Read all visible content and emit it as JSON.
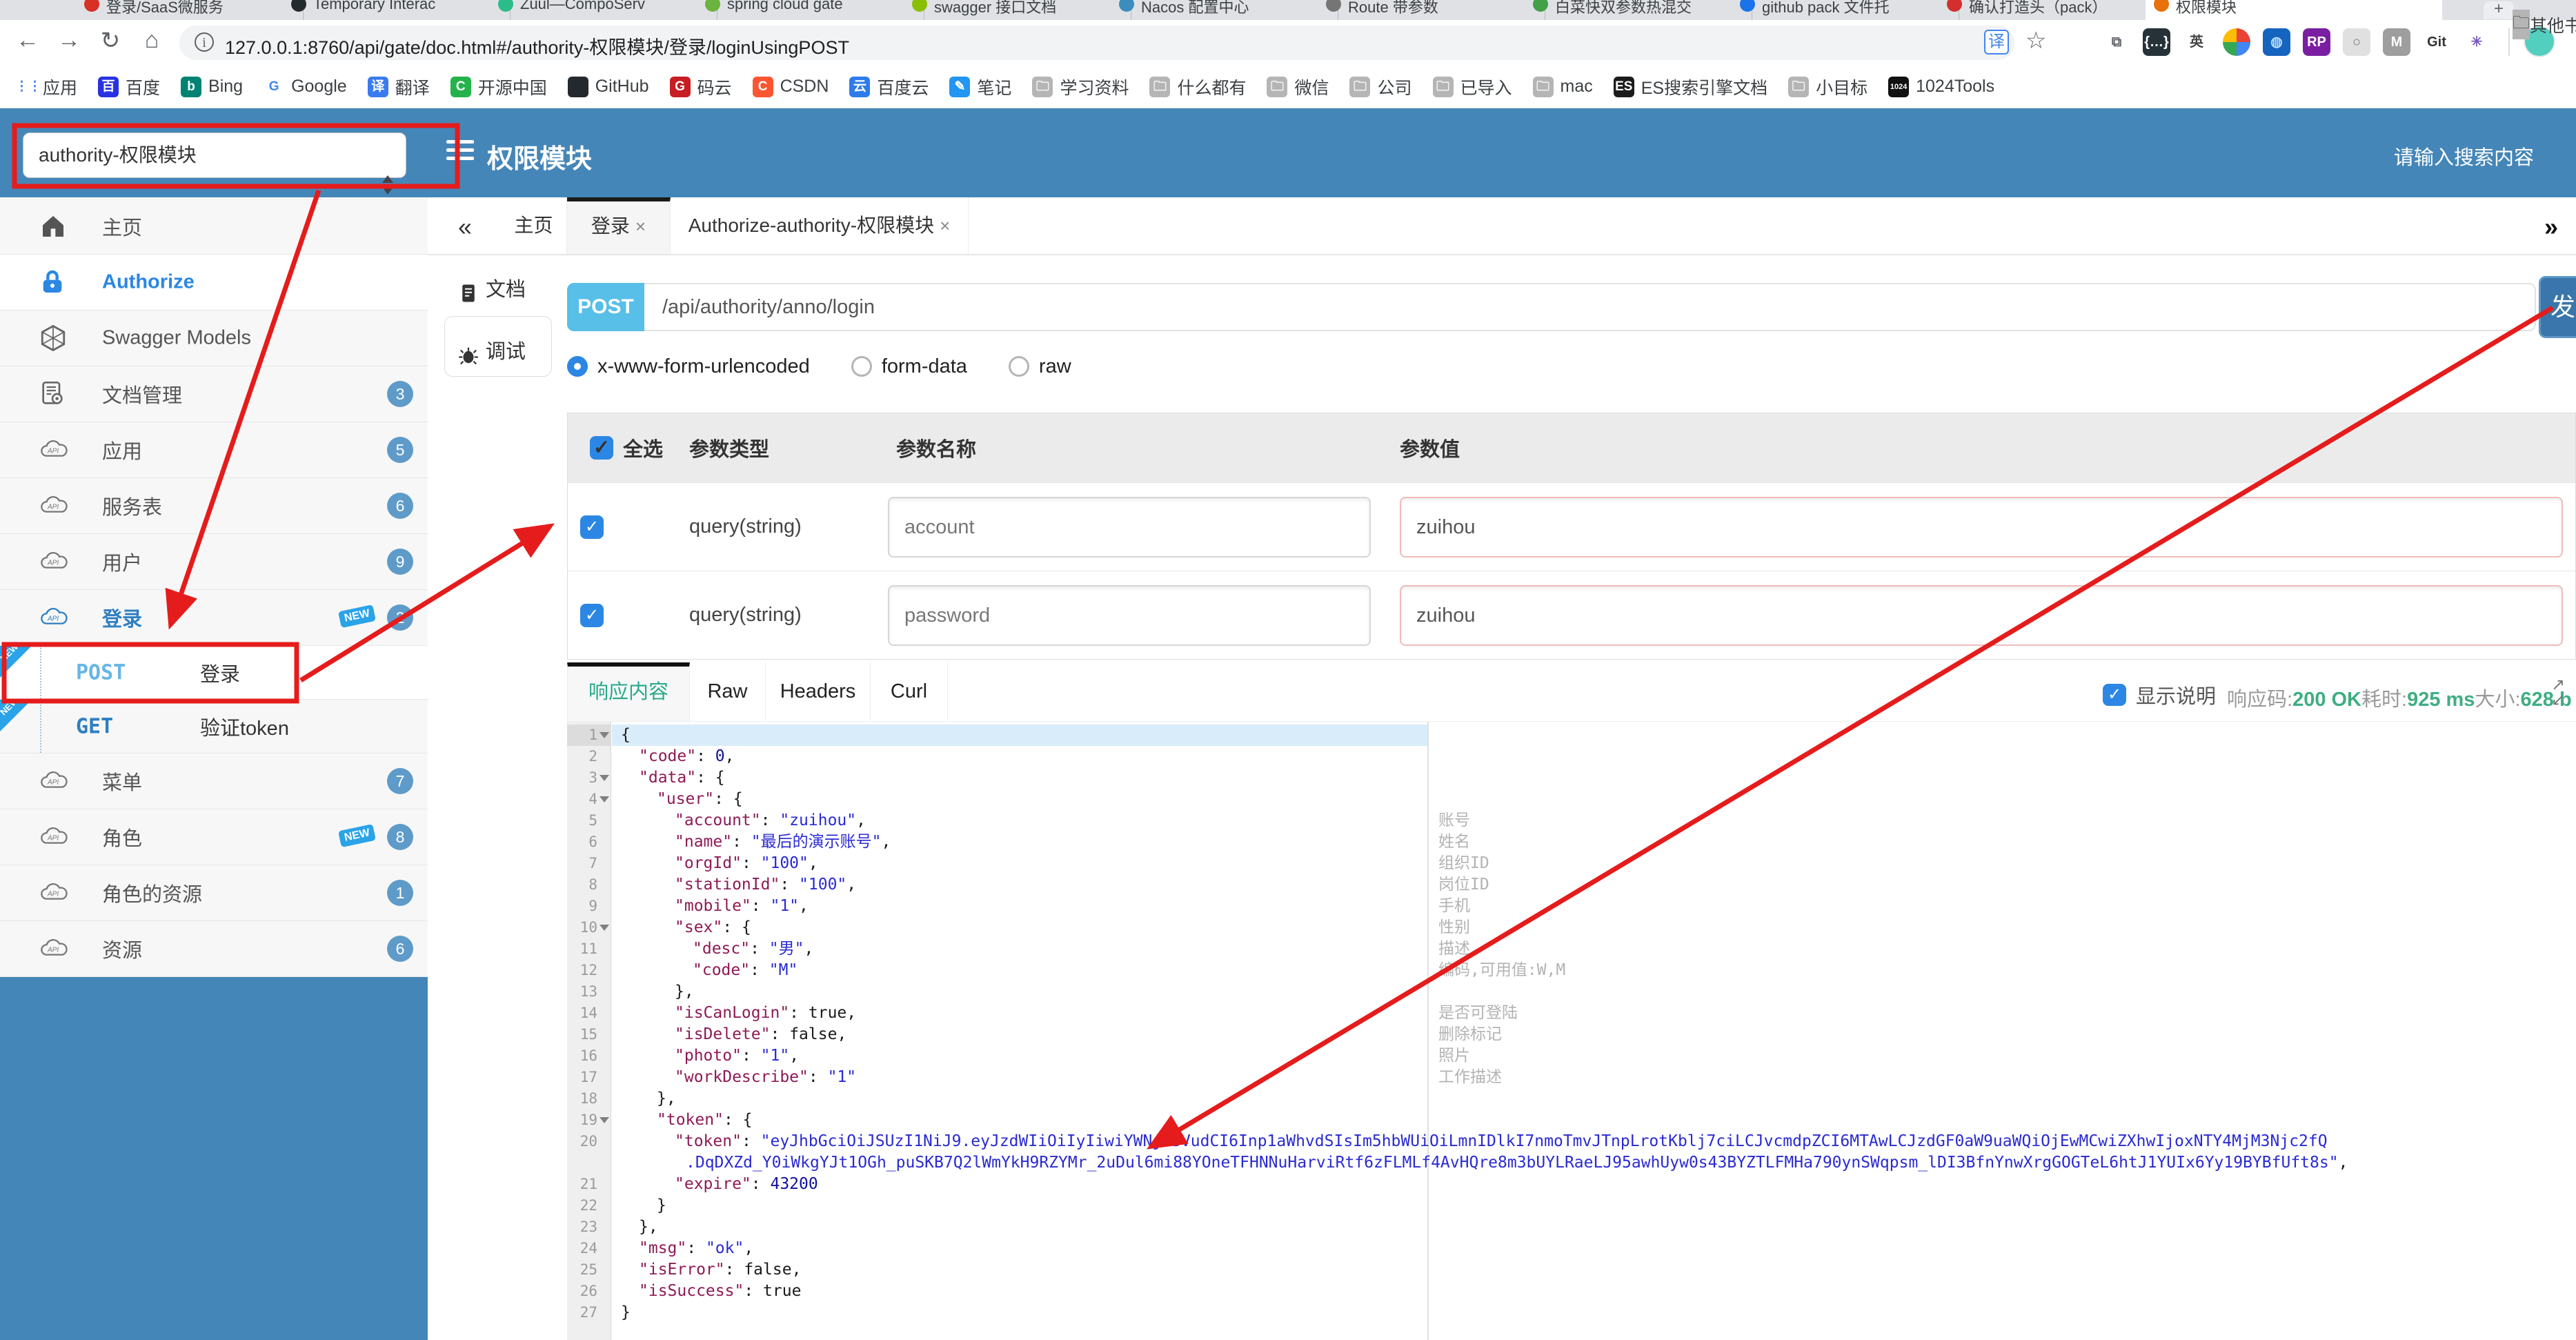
{
  "browser": {
    "tabs": [
      {
        "title": "登录/SaaS微服务",
        "color": "#d93025"
      },
      {
        "title": "Temporary Interac",
        "color": "#24292e"
      },
      {
        "title": "Zuul—CompoServ",
        "color": "#2bbc8a"
      },
      {
        "title": "spring cloud gate",
        "color": "#6db33f"
      },
      {
        "title": "swagger 接口文档",
        "color": "#89bf04"
      },
      {
        "title": "Nacos 配置中心",
        "color": "#3b8dbd"
      },
      {
        "title": "Route 带参数",
        "color": "#757575"
      },
      {
        "title": "白菜快双参数热混交",
        "color": "#43a047"
      },
      {
        "title": "github pack 文件托",
        "color": "#1a73e8"
      },
      {
        "title": "确认打造头（pack）",
        "color": "#d32f2f"
      },
      {
        "title": "权限模块",
        "color": "#e8710a",
        "active": true
      }
    ],
    "new_tab_label": "+",
    "nav": {
      "back": "←",
      "forward": "→",
      "reload": "↻",
      "home": "⌂"
    },
    "url": "127.0.0.1:8760/api/gate/doc.html#/authority-权限模块/登录/loginUsingPOST",
    "url_info_glyph": "i",
    "translate_glyph": "译",
    "star_glyph": "☆",
    "ext_icons": [
      "screenshot",
      "json-brackets",
      "en-translate",
      "chrome",
      "globe",
      "rp",
      "ring",
      "m-shield",
      "gitzip",
      "asterisk"
    ],
    "bookmarks": [
      {
        "label": "应用",
        "icon": "apps"
      },
      {
        "label": "百度",
        "icon": "baidu"
      },
      {
        "label": "Bing",
        "icon": "bing"
      },
      {
        "label": "Google",
        "icon": "google"
      },
      {
        "label": "翻译",
        "icon": "translate"
      },
      {
        "label": "开源中国",
        "icon": "oschina"
      },
      {
        "label": "GitHub",
        "icon": "github"
      },
      {
        "label": "码云",
        "icon": "gitee"
      },
      {
        "label": "CSDN",
        "icon": "csdn"
      },
      {
        "label": "百度云",
        "icon": "baiduyun"
      },
      {
        "label": "笔记",
        "icon": "note"
      },
      {
        "label": "学习资料",
        "icon": "folder"
      },
      {
        "label": "什么都有",
        "icon": "folder"
      },
      {
        "label": "微信",
        "icon": "folder"
      },
      {
        "label": "公司",
        "icon": "folder"
      },
      {
        "label": "已导入",
        "icon": "folder"
      },
      {
        "label": "mac",
        "icon": "folder"
      },
      {
        "label": "ES搜索引擎文档",
        "icon": "es"
      },
      {
        "label": "小目标",
        "icon": "folder"
      },
      {
        "label": "1024Tools",
        "icon": "t1024"
      }
    ],
    "bookmarks_more": "其他书签"
  },
  "header": {
    "module_select": "authority-权限模块",
    "title": "权限模块",
    "search_placeholder": "请输入搜索内容"
  },
  "sidebar": {
    "items": [
      {
        "key": "home",
        "label": "主页",
        "icon": "home",
        "type": "menu"
      },
      {
        "key": "authorize",
        "label": "Authorize",
        "icon": "lock",
        "type": "menu",
        "white": true,
        "blue": true
      },
      {
        "key": "swagger-models",
        "label": "Swagger Models",
        "icon": "models",
        "type": "menu"
      },
      {
        "key": "doc-manage",
        "label": "文档管理",
        "icon": "docgear",
        "type": "menu",
        "badge": "3"
      },
      {
        "key": "app",
        "label": "应用",
        "icon": "api",
        "type": "menu",
        "badge": "5"
      },
      {
        "key": "service-table",
        "label": "服务表",
        "icon": "api",
        "type": "menu",
        "badge": "6"
      },
      {
        "key": "user",
        "label": "用户",
        "icon": "api",
        "type": "menu",
        "badge": "9"
      },
      {
        "key": "login",
        "label": "登录",
        "icon": "api",
        "type": "menu",
        "badge": "2",
        "new": true,
        "blue": true
      },
      {
        "key": "login-post",
        "label": "登录",
        "method": "POST",
        "type": "endpoint",
        "white": true,
        "new": true
      },
      {
        "key": "verify-token-get",
        "label": "验证token",
        "method": "GET",
        "type": "endpoint",
        "new": true
      },
      {
        "key": "menu",
        "label": "菜单",
        "icon": "api",
        "type": "menu",
        "badge": "7"
      },
      {
        "key": "role",
        "label": "角色",
        "icon": "api",
        "type": "menu",
        "badge": "8",
        "new": true
      },
      {
        "key": "role-resource",
        "label": "角色的资源",
        "icon": "api",
        "type": "menu",
        "badge": "1"
      },
      {
        "key": "resource",
        "label": "资源",
        "icon": "api",
        "type": "menu",
        "badge": "6"
      }
    ]
  },
  "main_tabs": {
    "collapse": "«",
    "expand": "»",
    "items": [
      {
        "label": "主页"
      },
      {
        "label": "登录",
        "closable": true,
        "active": true
      },
      {
        "label": "Authorize-authority-权限模块",
        "closable": true
      }
    ]
  },
  "subnav": {
    "items": [
      {
        "key": "doc",
        "label": "文档"
      },
      {
        "key": "debug",
        "label": "调试",
        "active": true
      }
    ]
  },
  "request": {
    "method": "POST",
    "path": "/api/authority/anno/login",
    "send_label": "发",
    "content_types": [
      {
        "label": "x-www-form-urlencoded",
        "selected": true
      },
      {
        "label": "form-data"
      },
      {
        "label": "raw"
      }
    ],
    "params": {
      "headers": {
        "select_all": "全选",
        "type": "参数类型",
        "name": "参数名称",
        "value": "参数值"
      },
      "rows": [
        {
          "checked": true,
          "type": "query(string)",
          "name": "account",
          "value": "zuihou"
        },
        {
          "checked": true,
          "type": "query(string)",
          "name": "password",
          "value": "zuihou"
        }
      ]
    }
  },
  "response": {
    "tabs": [
      {
        "label": "响应内容",
        "active": true,
        "w": 178
      },
      {
        "label": "Raw",
        "w": 110
      },
      {
        "label": "Headers",
        "w": 152
      },
      {
        "label": "Curl",
        "w": 112
      }
    ],
    "show_desc_label": "显示说明",
    "show_desc_checked": true,
    "meta": [
      {
        "label": "响应码:",
        "value": "200 OK"
      },
      {
        "label": "耗时:",
        "value": "925 ms"
      },
      {
        "label": "大小:",
        "value": "628 b"
      }
    ],
    "json_lines": [
      {
        "num": "1",
        "exp": true,
        "hl": true,
        "ind": 0,
        "seg": [
          [
            "p",
            "{"
          ]
        ]
      },
      {
        "num": "2",
        "ind": 1,
        "seg": [
          [
            "k",
            "\"code\""
          ],
          [
            "p",
            ": "
          ],
          [
            "n",
            "0"
          ],
          [
            "p",
            ","
          ]
        ]
      },
      {
        "num": "3",
        "exp": true,
        "ind": 1,
        "seg": [
          [
            "k",
            "\"data\""
          ],
          [
            "p",
            ": {"
          ]
        ]
      },
      {
        "num": "4",
        "exp": true,
        "ind": 2,
        "seg": [
          [
            "k",
            "\"user\""
          ],
          [
            "p",
            ": {"
          ]
        ]
      },
      {
        "num": "5",
        "ind": 3,
        "ann": "账号",
        "seg": [
          [
            "k",
            "\"account\""
          ],
          [
            "p",
            ": "
          ],
          [
            "s",
            "\"zuihou\""
          ],
          [
            "p",
            ","
          ]
        ]
      },
      {
        "num": "6",
        "ind": 3,
        "ann": "姓名",
        "seg": [
          [
            "k",
            "\"name\""
          ],
          [
            "p",
            ": "
          ],
          [
            "s",
            "\"最后的演示账号\""
          ],
          [
            "p",
            ","
          ]
        ]
      },
      {
        "num": "7",
        "ind": 3,
        "ann": "组织ID",
        "seg": [
          [
            "k",
            "\"orgId\""
          ],
          [
            "p",
            ": "
          ],
          [
            "s",
            "\"100\""
          ],
          [
            "p",
            ","
          ]
        ]
      },
      {
        "num": "8",
        "ind": 3,
        "ann": "岗位ID",
        "seg": [
          [
            "k",
            "\"stationId\""
          ],
          [
            "p",
            ": "
          ],
          [
            "s",
            "\"100\""
          ],
          [
            "p",
            ","
          ]
        ]
      },
      {
        "num": "9",
        "ind": 3,
        "ann": "手机",
        "seg": [
          [
            "k",
            "\"mobile\""
          ],
          [
            "p",
            ": "
          ],
          [
            "s",
            "\"1\""
          ],
          [
            "p",
            ","
          ]
        ]
      },
      {
        "num": "10",
        "exp": true,
        "ind": 3,
        "ann": "性别",
        "seg": [
          [
            "k",
            "\"sex\""
          ],
          [
            "p",
            ": {"
          ]
        ]
      },
      {
        "num": "11",
        "ind": 4,
        "ann": "描述",
        "seg": [
          [
            "k",
            "\"desc\""
          ],
          [
            "p",
            ": "
          ],
          [
            "s",
            "\"男\""
          ],
          [
            "p",
            ","
          ]
        ]
      },
      {
        "num": "12",
        "ind": 4,
        "ann": "编码,可用值:W,M",
        "seg": [
          [
            "k",
            "\"code\""
          ],
          [
            "p",
            ": "
          ],
          [
            "s",
            "\"M\""
          ]
        ]
      },
      {
        "num": "13",
        "ind": 3,
        "seg": [
          [
            "p",
            "},"
          ]
        ]
      },
      {
        "num": "14",
        "ind": 3,
        "ann": "是否可登陆",
        "seg": [
          [
            "k",
            "\"isCanLogin\""
          ],
          [
            "p",
            ": "
          ],
          [
            "b",
            "true"
          ],
          [
            "p",
            ","
          ]
        ]
      },
      {
        "num": "15",
        "ind": 3,
        "ann": "删除标记",
        "seg": [
          [
            "k",
            "\"isDelete\""
          ],
          [
            "p",
            ": "
          ],
          [
            "b",
            "false"
          ],
          [
            "p",
            ","
          ]
        ]
      },
      {
        "num": "16",
        "ind": 3,
        "ann": "照片",
        "seg": [
          [
            "k",
            "\"photo\""
          ],
          [
            "p",
            ": "
          ],
          [
            "s",
            "\"1\""
          ],
          [
            "p",
            ","
          ]
        ]
      },
      {
        "num": "17",
        "ind": 3,
        "ann": "工作描述",
        "seg": [
          [
            "k",
            "\"workDescribe\""
          ],
          [
            "p",
            ": "
          ],
          [
            "s",
            "\"1\""
          ]
        ]
      },
      {
        "num": "18",
        "ind": 2,
        "seg": [
          [
            "p",
            "},"
          ]
        ]
      },
      {
        "num": "19",
        "exp": true,
        "ind": 2,
        "seg": [
          [
            "k",
            "\"token\""
          ],
          [
            "p",
            ": {"
          ]
        ]
      },
      {
        "num": "20",
        "ind": 3,
        "seg": [
          [
            "k",
            "\"token\""
          ],
          [
            "p",
            ": "
          ],
          [
            "s",
            "\"eyJhbGciOiJSUzI1NiJ9.eyJzdWIiOiIyIiwiYWNjb3VudCI6Inp1aWhvdSIsIm5hbWUiOiLmnIDlkI7nmoTmvJTnpLrotKblj7ciLCJvcmdpZCI6MTAwLCJzdGF0aW9uaWQiOjEwMCwiZXhwIjoxNTY4MjM3Njc2fQ"
          ]
        ]
      },
      {
        "wrap": true,
        "seg": [
          [
            "s",
            ".DqDXZd_Y0iWkgYJt1OGh_puSKB7Q2lWmYkH9RZYMr_2uDul6mi88YOneTFHNNuHarviRtf6zFLMLf4AvHQre8m3bUYLRaeLJ95awhUyw0s43BYZTLFMHa790ynSWqpsm_lDI3BfnYnwXrgGOGTeL6htJ1YUIx6Yy19BYBfUft8s\""
          ],
          [
            "p",
            ","
          ]
        ]
      },
      {
        "num": "21",
        "ind": 3,
        "seg": [
          [
            "k",
            "\"expire\""
          ],
          [
            "p",
            ": "
          ],
          [
            "n",
            "43200"
          ]
        ]
      },
      {
        "num": "22",
        "ind": 2,
        "seg": [
          [
            "p",
            "}"
          ]
        ]
      },
      {
        "num": "23",
        "ind": 1,
        "seg": [
          [
            "p",
            "},"
          ]
        ]
      },
      {
        "num": "24",
        "ind": 1,
        "seg": [
          [
            "k",
            "\"msg\""
          ],
          [
            "p",
            ": "
          ],
          [
            "s",
            "\"ok\""
          ],
          [
            "p",
            ","
          ]
        ]
      },
      {
        "num": "25",
        "ind": 1,
        "seg": [
          [
            "k",
            "\"isError\""
          ],
          [
            "p",
            ": "
          ],
          [
            "b",
            "false"
          ],
          [
            "p",
            ","
          ]
        ]
      },
      {
        "num": "26",
        "ind": 1,
        "seg": [
          [
            "k",
            "\"isSuccess\""
          ],
          [
            "p",
            ": "
          ],
          [
            "b",
            "true"
          ]
        ]
      },
      {
        "num": "27",
        "ind": 0,
        "seg": [
          [
            "p",
            "}"
          ]
        ]
      }
    ]
  },
  "annotation_colors": {
    "red": "#e51c1c",
    "header_blue": "#4586b8",
    "accent_blue": "#2b87e3",
    "green": "#3fae83",
    "post_cyan": "#57bfe8"
  }
}
